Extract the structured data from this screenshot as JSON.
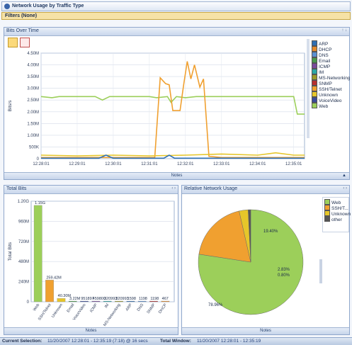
{
  "window": {
    "title": "Network Usage by Traffic Type",
    "filters_label": "Filters (None)"
  },
  "top_panel": {
    "tab_label": "Bits Over Time",
    "controls": "↑ ↓",
    "notes_label": "Notes",
    "collapse_glyph": "▲",
    "legend": [
      {
        "label": "ARP",
        "color": "#2f6fb3",
        "checked": true
      },
      {
        "label": "DHCP",
        "color": "#e58a2a",
        "checked": true
      },
      {
        "label": "DNS",
        "color": "#5b8fd1",
        "checked": true
      },
      {
        "label": "Email",
        "color": "#4a9a4a",
        "checked": true
      },
      {
        "label": "ICMP",
        "color": "#7a4a9a",
        "checked": true
      },
      {
        "label": "IM",
        "color": "#2aa6a6",
        "checked": true
      },
      {
        "label": "MS-Networking",
        "color": "#9a9a2a",
        "checked": true
      },
      {
        "label": "SNMP",
        "color": "#b53030",
        "checked": true
      },
      {
        "label": "SSH/Telnet",
        "color": "#f0a030",
        "checked": true
      },
      {
        "label": "Unknown",
        "color": "#e6c62a",
        "checked": true
      },
      {
        "label": "VoiceVideo",
        "color": "#3a4a9a",
        "checked": true
      },
      {
        "label": "Web",
        "color": "#9ccf5a",
        "checked": true
      }
    ]
  },
  "bottom_left_panel": {
    "tab_label": "Total Bits",
    "controls": "‹ ›",
    "notes_label": "Notes"
  },
  "bottom_right_panel": {
    "tab_label": "Relative Network Usage",
    "controls": "‹ ›",
    "notes_label": "Notes",
    "legend": [
      {
        "label": "Web",
        "color": "#9ccf5a"
      },
      {
        "label": "SSH/T...",
        "color": "#f0a030"
      },
      {
        "label": "Unknown",
        "color": "#e6c62a"
      },
      {
        "label": "other",
        "color": "#555555"
      }
    ]
  },
  "status": {
    "current_selection_label": "Current Selection:",
    "current_selection_value": "11/20/2007 12:28:01 - 12:35:19 (7:18) @ 16 secs",
    "total_window_label": "Total Window:",
    "total_window_value": "11/20/2007 12:28:01 - 12:35:19"
  },
  "chart_data": [
    {
      "type": "line",
      "ylabel": "Bits/s",
      "xlabel": "",
      "ylim": [
        0,
        4500000
      ],
      "y_tick_labels": [
        "0",
        "500K",
        "1.00M",
        "1.50M",
        "2.00M",
        "2.50M",
        "3.00M",
        "3.50M",
        "4.00M",
        "4.50M"
      ],
      "x_tick_labels": [
        "12:28:01",
        "12:29:01",
        "12:30:01",
        "12:31:01",
        "12:32:01",
        "12:33:01",
        "12:34:01",
        "12:35:01"
      ],
      "x_minutes": [
        0,
        0.5,
        1,
        1.5,
        2,
        2.5,
        3,
        3.5,
        4,
        4.5,
        5,
        5.5,
        6,
        6.5,
        7,
        7.3
      ],
      "series": [
        {
          "name": "Web",
          "color": "#9ccf5a",
          "points": [
            [
              0,
              2650000
            ],
            [
              0.3,
              2600000
            ],
            [
              0.5,
              2650000
            ],
            [
              1,
              2650000
            ],
            [
              1.5,
              2650000
            ],
            [
              1.7,
              2500000
            ],
            [
              1.9,
              2650000
            ],
            [
              2.5,
              2650000
            ],
            [
              3,
              2650000
            ],
            [
              3.2,
              2600000
            ],
            [
              3.5,
              2650000
            ],
            [
              3.6,
              2400000
            ],
            [
              3.75,
              2650000
            ],
            [
              4,
              2600000
            ],
            [
              4.3,
              2650000
            ],
            [
              5,
              2650000
            ],
            [
              6,
              2650000
            ],
            [
              7,
              2650000
            ],
            [
              7.1,
              1900000
            ],
            [
              7.3,
              1900000
            ]
          ]
        },
        {
          "name": "SSH/Telnet",
          "color": "#f0a030",
          "points": [
            [
              0,
              50000
            ],
            [
              1,
              50000
            ],
            [
              2,
              50000
            ],
            [
              3,
              50000
            ],
            [
              3.15,
              50000
            ],
            [
              3.3,
              3450000
            ],
            [
              3.45,
              3200000
            ],
            [
              3.55,
              3150000
            ],
            [
              3.65,
              2050000
            ],
            [
              3.85,
              2050000
            ],
            [
              3.95,
              3150000
            ],
            [
              4.05,
              4150000
            ],
            [
              4.15,
              3400000
            ],
            [
              4.25,
              4000000
            ],
            [
              4.4,
              3050000
            ],
            [
              4.5,
              3400000
            ],
            [
              4.65,
              100000
            ],
            [
              5,
              50000
            ],
            [
              6,
              50000
            ],
            [
              7,
              50000
            ],
            [
              7.3,
              50000
            ]
          ]
        },
        {
          "name": "Unknown",
          "color": "#e6c62a",
          "points": [
            [
              0,
              150000
            ],
            [
              1,
              120000
            ],
            [
              2,
              150000
            ],
            [
              3,
              120000
            ],
            [
              4,
              150000
            ],
            [
              5,
              200000
            ],
            [
              6,
              150000
            ],
            [
              6.5,
              250000
            ],
            [
              7,
              150000
            ],
            [
              7.3,
              150000
            ]
          ]
        },
        {
          "name": "ARP",
          "color": "#2f6fb3",
          "points": [
            [
              0,
              20000
            ],
            [
              1.6,
              20000
            ],
            [
              1.8,
              150000
            ],
            [
              2,
              20000
            ],
            [
              3.4,
              20000
            ],
            [
              3.55,
              150000
            ],
            [
              3.7,
              20000
            ],
            [
              7.3,
              20000
            ]
          ]
        }
      ]
    },
    {
      "type": "bar",
      "ylabel": "Total Bits",
      "xlabel": "",
      "ylim": [
        0,
        1200000000
      ],
      "y_tick_labels": [
        "0",
        "240M",
        "480M",
        "720M",
        "960M",
        "1.20G"
      ],
      "categories": [
        "Web",
        "SSH/Telnet",
        "Unknown",
        "Email",
        "VoiceVideo",
        "ICMP",
        "IM",
        "MS-Networking",
        "ARP",
        "DNS",
        "SNMP",
        "DHCP"
      ],
      "values": [
        1150000000,
        259420000,
        40300000,
        3220000,
        951897,
        459800,
        320993,
        320993,
        1598,
        1198,
        1198,
        467
      ],
      "value_labels": [
        "1.15G",
        "259.42M",
        "40.30M",
        "3.22M",
        "951897",
        "459800",
        "320993",
        "320993",
        "1598",
        "1198",
        "1198",
        "467"
      ],
      "colors": [
        "#9ccf5a",
        "#f0a030",
        "#e6c62a",
        "#4a9a4a",
        "#3a4a9a",
        "#7a4a9a",
        "#2aa6a6",
        "#9a9a2a",
        "#2f6fb3",
        "#5b8fd1",
        "#b53030",
        "#e58a2a"
      ]
    },
    {
      "type": "pie",
      "slices": [
        {
          "label": "Web",
          "value": 78.96,
          "text": "78.96%",
          "color": "#9ccf5a"
        },
        {
          "label": "SSH/T...",
          "value": 19.4,
          "text": "19.40%",
          "color": "#f0a030"
        },
        {
          "label": "Unknown",
          "value": 2.83,
          "text": "2.83%",
          "color": "#e6c62a"
        },
        {
          "label": "other",
          "value": 0.8,
          "text": "0.80%",
          "color": "#555555"
        }
      ]
    }
  ]
}
